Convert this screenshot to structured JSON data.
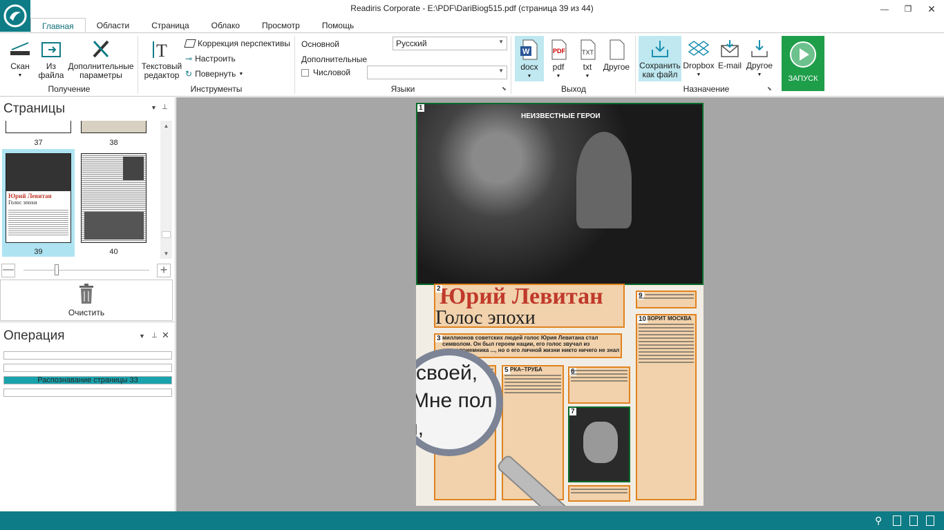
{
  "window": {
    "title": "Readiris Corporate - E:\\PDF\\DariBiog515.pdf (страница 39 из 44)"
  },
  "tabs": [
    "Главная",
    "Области",
    "Страница",
    "Облако",
    "Просмотр",
    "Помощь"
  ],
  "ribbon": {
    "acquire": {
      "scan": "Скан",
      "from_file_1": "Из",
      "from_file_2": "файла",
      "extra_1": "Дополнительные",
      "extra_2": "параметры",
      "group": "Получение"
    },
    "tools": {
      "text_editor_1": "Текстовый",
      "text_editor_2": "редактор",
      "perspective": "Коррекция перспективы",
      "adjust": "Настроить",
      "rotate": "Повернуть",
      "group": "Инструменты"
    },
    "languages": {
      "main_label": "Основной",
      "main_value": "Русский",
      "extra_label": "Дополнительные",
      "extra_value": "",
      "numeric": "Числовой",
      "group": "Языки"
    },
    "output": {
      "docx": "docx",
      "pdf": "pdf",
      "txt": "txt",
      "other": "Другое",
      "group": "Выход",
      "pdf_icon_text": "PDF",
      "txt_icon_text": "TXT"
    },
    "destination": {
      "save_1": "Сохранить",
      "save_2": "как файл",
      "dropbox": "Dropbox",
      "email": "E-mail",
      "other": "Другое",
      "group": "Назначение"
    },
    "run": "ЗАПУСК"
  },
  "pages_panel": {
    "title": "Страницы",
    "pages": [
      "37",
      "38",
      "39",
      "40"
    ],
    "clear": "Очистить"
  },
  "operation_panel": {
    "title": "Операция",
    "progress_text": "Распознавание страницы 33"
  },
  "document": {
    "header": "НЕИЗВЕСТНЫЕ ГЕРОИ",
    "headline": "Юрий Левитан",
    "subhead": "Голос эпохи",
    "lead": "миллионов советских людей голос Юрия Левитана стал символом. Он был героем нации, его голос звучал из радиоприемника ..., но о его личной жизни никто ничего не знал – ...",
    "magnifier_lines": [
      "своей,",
      "Мне  пол",
      "й, пожалу"
    ],
    "zone_nums": [
      "1",
      "2",
      "3",
      "5",
      "6",
      "7",
      "9",
      "10"
    ],
    "col_heads": [
      "РКА–ТРУБА",
      "ВОРИТ МОСКВА"
    ]
  },
  "colors": {
    "accent": "#0e7c86",
    "zone": "#e0821e",
    "viewer_bg": "#a6a6a6",
    "run": "#1f9e4a"
  }
}
